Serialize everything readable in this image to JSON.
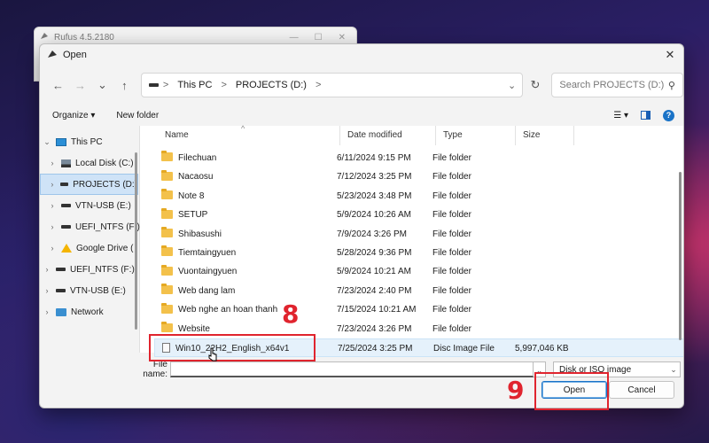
{
  "rufus_window": {
    "title": "Rufus 4.5.2180"
  },
  "dialog": {
    "title": "Open",
    "close_glyph": "✕"
  },
  "address_bar": {
    "crumbs": [
      "This PC",
      "PROJECTS (D:)"
    ],
    "separator": ">"
  },
  "search": {
    "placeholder": "Search PROJECTS (D:)"
  },
  "toolbar": {
    "organize": "Organize ▾",
    "new_folder": "New folder",
    "help": "?"
  },
  "sidebar": {
    "items": [
      {
        "label": "This PC",
        "icon": "computer-icon"
      },
      {
        "label": "Local Disk (C:)",
        "icon": "local-disk-icon"
      },
      {
        "label": "PROJECTS (D:)",
        "icon": "drive-icon"
      },
      {
        "label": "VTN-USB (E:)",
        "icon": "drive-icon"
      },
      {
        "label": "UEFI_NTFS (F:)",
        "icon": "drive-icon"
      },
      {
        "label": "Google Drive (",
        "icon": "google-drive-icon"
      },
      {
        "label": "UEFI_NTFS (F:)",
        "icon": "drive-icon"
      },
      {
        "label": "VTN-USB (E:)",
        "icon": "drive-icon"
      },
      {
        "label": "Network",
        "icon": "network-icon"
      }
    ]
  },
  "file_list": {
    "columns": [
      "Name",
      "Date modified",
      "Type",
      "Size"
    ],
    "rows": [
      {
        "name": "Filechuan",
        "date": "6/11/2024 9:15 PM",
        "type": "File folder",
        "size": ""
      },
      {
        "name": "Nacaosu",
        "date": "7/12/2024 3:25 PM",
        "type": "File folder",
        "size": ""
      },
      {
        "name": "Note 8",
        "date": "5/23/2024 3:48 PM",
        "type": "File folder",
        "size": ""
      },
      {
        "name": "SETUP",
        "date": "5/9/2024 10:26 AM",
        "type": "File folder",
        "size": ""
      },
      {
        "name": "Shibasushi",
        "date": "7/9/2024 3:26 PM",
        "type": "File folder",
        "size": ""
      },
      {
        "name": "Tiemtaingyuen",
        "date": "5/28/2024 9:36 PM",
        "type": "File folder",
        "size": ""
      },
      {
        "name": "Vuontaingyuen",
        "date": "5/9/2024 10:21 AM",
        "type": "File folder",
        "size": ""
      },
      {
        "name": "Web dang lam",
        "date": "7/23/2024 2:40 PM",
        "type": "File folder",
        "size": ""
      },
      {
        "name": "Web nghe an hoan thanh",
        "date": "7/15/2024 10:21 AM",
        "type": "File folder",
        "size": ""
      },
      {
        "name": "Website",
        "date": "7/23/2024 3:26 PM",
        "type": "File folder",
        "size": ""
      },
      {
        "name": "Win10_22H2_English_x64v1",
        "date": "7/25/2024 3:25 PM",
        "type": "Disc Image File",
        "size": "5,997,046 KB"
      }
    ]
  },
  "file_name": {
    "label": "File name:",
    "value": ""
  },
  "file_type": {
    "selected": "Disk or ISO image"
  },
  "buttons": {
    "open": "Open",
    "cancel": "Cancel"
  },
  "annotations": {
    "step_select": "8",
    "step_open": "9",
    "color": "#e0242e"
  }
}
